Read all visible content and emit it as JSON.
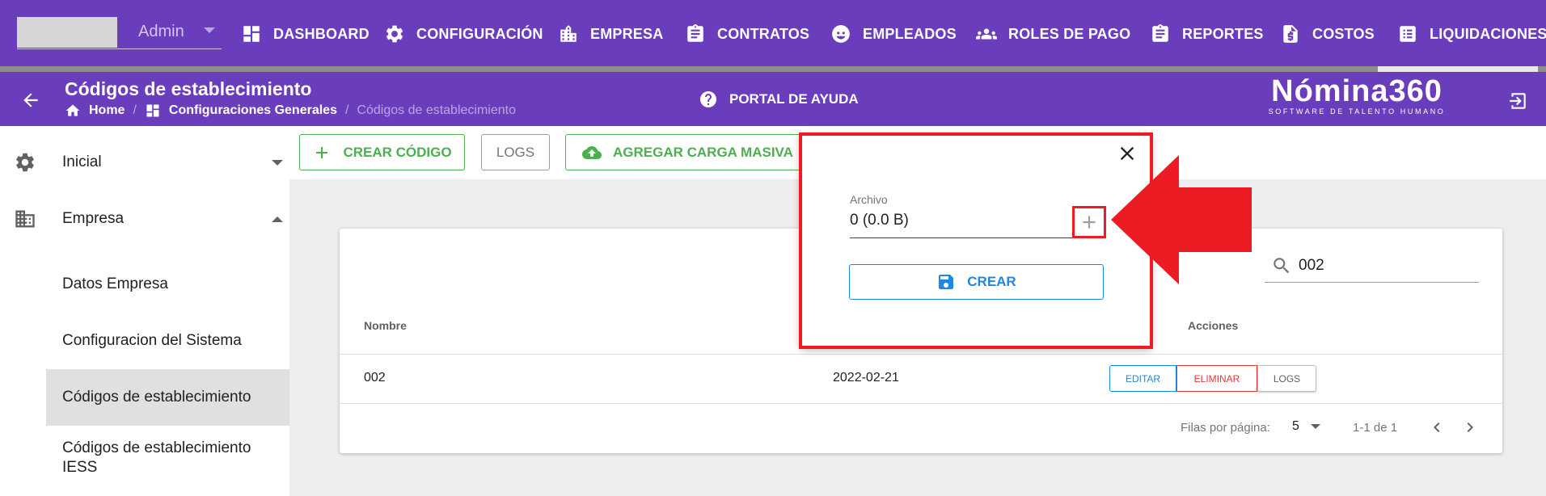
{
  "topnav": {
    "user_name": "Admin",
    "items": [
      {
        "label": "DASHBOARD",
        "icon": "dashboard-icon"
      },
      {
        "label": "CONFIGURACIÓN",
        "icon": "gear-icon"
      },
      {
        "label": "EMPRESA",
        "icon": "building-icon"
      },
      {
        "label": "CONTRATOS",
        "icon": "clipboard-icon"
      },
      {
        "label": "EMPLEADOS",
        "icon": "face-icon"
      },
      {
        "label": "ROLES DE PAGO",
        "icon": "group-icon"
      },
      {
        "label": "REPORTES",
        "icon": "clipboard-icon"
      },
      {
        "label": "COSTOS",
        "icon": "cost-document-icon"
      },
      {
        "label": "LIQUIDACIONES",
        "icon": "list-icon"
      }
    ]
  },
  "subheader": {
    "title": "Códigos de establecimiento",
    "breadcrumb": {
      "home": "Home",
      "parent": "Configuraciones Generales",
      "current": "Códigos de establecimiento"
    },
    "help_label": "PORTAL DE AYUDA",
    "logo_main": "Nómina360",
    "logo_sub": "SOFTWARE DE TALENTO HUMANO"
  },
  "sidebar": {
    "groups": [
      {
        "label": "Inicial",
        "icon": "gear-icon",
        "expanded": false
      },
      {
        "label": "Empresa",
        "icon": "building-icon",
        "expanded": true
      }
    ],
    "sub_items": [
      "Datos Empresa",
      "Configuracion del Sistema",
      "Códigos de establecimiento",
      "Códigos de establecimiento IESS"
    ]
  },
  "toolbar": {
    "create_label": "CREAR CÓDIGO",
    "logs_label": "LOGS",
    "bulk_label": "AGREGAR CARGA MASIVA"
  },
  "table": {
    "search_value": "002",
    "headers": {
      "name": "Nombre",
      "actions": "Acciones"
    },
    "rows": [
      {
        "name": "002",
        "date": "2022-02-21"
      }
    ],
    "actions": {
      "edit": "EDITAR",
      "delete": "ELIMINAR",
      "logs": "LOGS"
    },
    "footer": {
      "rows_per_page_label": "Filas por página:",
      "rows_per_page": "5",
      "range": "1-1 de 1"
    }
  },
  "dialog": {
    "file_label": "Archivo",
    "file_value": "0 (0.0 B)",
    "create_label": "CREAR"
  },
  "colors": {
    "primary": "#6a3dbd",
    "green": "#4caf50",
    "blue": "#1e88e5",
    "red": "#ed1c24"
  }
}
